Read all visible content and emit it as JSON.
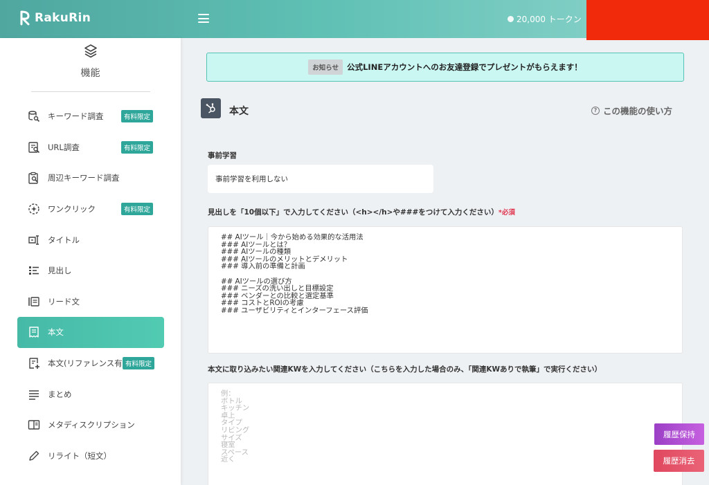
{
  "header": {
    "app_name": "RakuRin",
    "tokens": "20,000 トークン"
  },
  "sidebar": {
    "title": "機能",
    "items": [
      {
        "label": "キーワード調査",
        "badge": "有料限定",
        "icon": "keyword-search-icon"
      },
      {
        "label": "URL調査",
        "badge": "有料限定",
        "icon": "url-search-icon"
      },
      {
        "label": "周辺キーワード調査",
        "badge": "",
        "icon": "clipboard-search-icon"
      },
      {
        "label": "ワンクリック",
        "badge": "有料限定",
        "icon": "one-click-icon"
      },
      {
        "label": "タイトル",
        "badge": "",
        "icon": "title-icon"
      },
      {
        "label": "見出し",
        "badge": "",
        "icon": "headings-icon"
      },
      {
        "label": "リード文",
        "badge": "",
        "icon": "lead-text-icon"
      },
      {
        "label": "本文",
        "badge": "",
        "icon": "receipt-icon",
        "active": true
      },
      {
        "label": "本文(リファレンス有)",
        "badge": "有料限定",
        "icon": "note-add-icon"
      },
      {
        "label": "まとめ",
        "badge": "",
        "icon": "lines-icon"
      },
      {
        "label": "メタディスクリプション",
        "badge": "",
        "icon": "book-icon"
      },
      {
        "label": "リライト（短文）",
        "badge": "",
        "icon": "pencil-icon"
      }
    ]
  },
  "notice": {
    "tag": "お知らせ",
    "text": "公式LINEアカウントへのお友達登録でプレゼントがもらえます！"
  },
  "page": {
    "title": "本文",
    "help": "この機能の使い方"
  },
  "form": {
    "pre_learning_label": "事前学習",
    "pre_learning_value": "事前学習を利用しない",
    "outline_label": "見出しを「10個以下」で入力してください（<h></h>や###をつけて入力ください）",
    "required": "*必須",
    "outline_lines": [
      "## AIツール｜今から始める効果的な活用法",
      "### AIツールとは？",
      "### AIツールの種類",
      "### AIツールのメリットとデメリット",
      "### 導入前の準備と計画",
      "",
      "## AIツールの選び方",
      "### ニーズの洗い出しと目標設定",
      "### ベンダーとの比較と選定基準",
      "### コストとROIの考慮",
      "### ユーザビリティとインターフェース評価"
    ],
    "kw_label": "本文に取り込みたい関連KWを入力してください（こちらを入力した場合のみ、「関連KWありで執筆」で実行ください）",
    "kw_placeholder": [
      "例：",
      "ボトル",
      "キッチン",
      "卓上",
      "タイプ",
      "リビング",
      "サイズ",
      "寝室",
      "スペース",
      "近く"
    ]
  },
  "buttons": {
    "keep_history": "履歴保持",
    "clear_history": "履歴消去"
  }
}
